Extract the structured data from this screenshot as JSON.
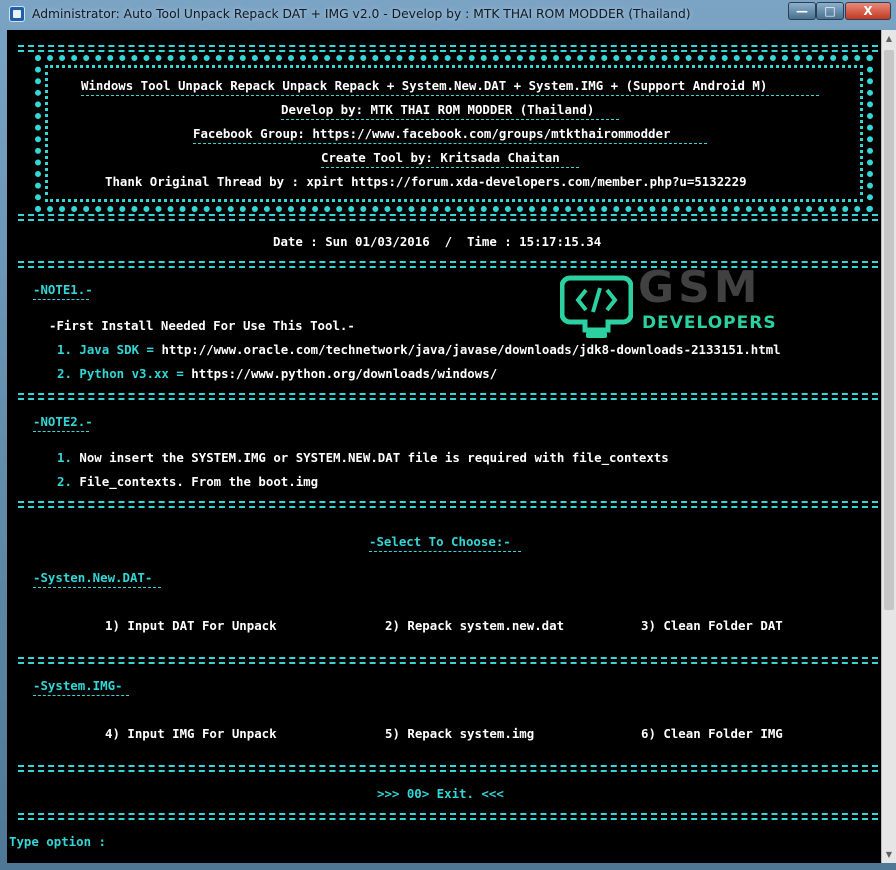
{
  "window": {
    "title": "Administrator:  Auto Tool Unpack Repack DAT + IMG v2.0 - Develop by : MTK THAI ROM MODDER (Thailand)",
    "controls": {
      "minimize": "—",
      "maximize": "□",
      "close": "X"
    }
  },
  "header": {
    "line1": "Windows Tool Unpack Repack Unpack Repack + System.New.DAT + System.IMG + (Support Android M)",
    "line2": "Develop by: MTK THAI ROM MODDER (Thailand)",
    "line3": "Facebook Group: https://www.facebook.com/groups/mtkthairommodder",
    "line4": "Create Tool by: Kritsada Chaitan",
    "line5": "Thank Original Thread by : xpirt https://forum.xda-developers.com/member.php?u=5132229"
  },
  "datetime": "Date : Sun 01/03/2016  /  Time : 15:17:15.34",
  "note1": {
    "label": "-NOTE1.-",
    "intro": "-First Install Needed For Use This Tool.-",
    "item1_prefix": "1. Java SDK =",
    "item1_url": "http://www.oracle.com/technetwork/java/javase/downloads/jdk8-downloads-2133151.html",
    "item2_prefix": "2. Python v3.xx =",
    "item2_url": "https://www.python.org/downloads/windows/"
  },
  "note2": {
    "label": "-NOTE2.-",
    "item1_num": "1.",
    "item1_text": "Now insert the SYSTEM.IMG or SYSTEM.NEW.DAT file is required with file_contexts",
    "item2_num": "2.",
    "item2_text": "File_contexts. From the boot.img"
  },
  "menu": {
    "select_title": "-Select To Choose:-",
    "dat_section": "-Systen.New.DAT-",
    "opt1": "1) Input DAT For Unpack",
    "opt2": "2) Repack system.new.dat",
    "opt3": "3) Clean Folder DAT",
    "img_section": "-System.IMG-",
    "opt4": "4) Input IMG For Unpack",
    "opt5": "5) Repack system.img",
    "opt6": "6) Clean Folder IMG",
    "exit": ">>> 00> Exit. <<<"
  },
  "prompt": "Type option :",
  "watermark": {
    "brand": "GSM",
    "sub": "DEVELOPERS"
  },
  "colors": {
    "console_bg": "#000000",
    "cyan": "#34d6d6",
    "white": "#ffffff",
    "watermark_green": "#2bd1a1"
  }
}
